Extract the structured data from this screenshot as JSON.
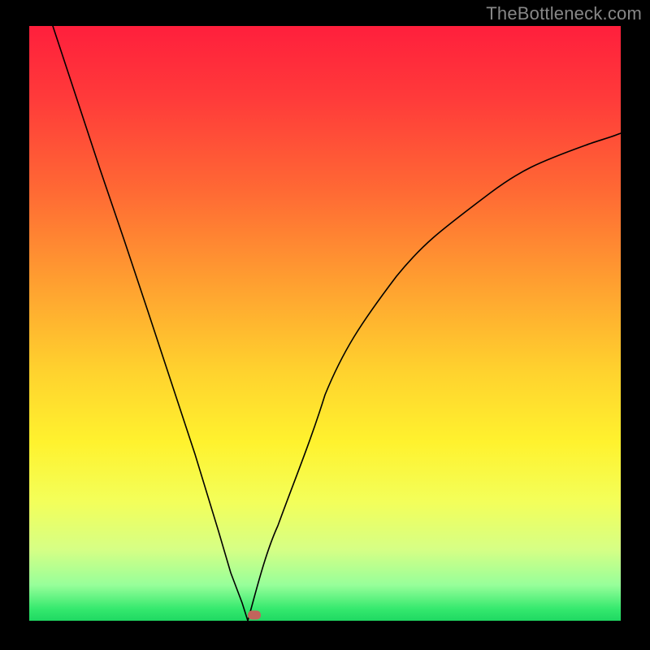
{
  "watermark": "TheBottleneck.com",
  "chart_data": {
    "type": "line",
    "title": "",
    "xlabel": "",
    "ylabel": "",
    "xlim": [
      0,
      100
    ],
    "ylim": [
      0,
      100
    ],
    "grid": false,
    "trough_x": 37,
    "marker": {
      "x": 38,
      "y": 1
    },
    "series": [
      {
        "name": "left-branch",
        "x": [
          4,
          8,
          12,
          16,
          20,
          24,
          28,
          32,
          34,
          36,
          37
        ],
        "y": [
          100,
          88,
          76,
          64,
          52,
          40,
          28,
          15,
          8,
          3,
          0
        ]
      },
      {
        "name": "right-branch",
        "x": [
          37,
          39,
          42,
          46,
          50,
          56,
          62,
          70,
          78,
          86,
          94,
          100
        ],
        "y": [
          0,
          6,
          16,
          28,
          38,
          50,
          58,
          66,
          72,
          77,
          80,
          82
        ]
      }
    ],
    "background_gradient": {
      "stops": [
        {
          "pos": 0,
          "color": "#ff1f3c"
        },
        {
          "pos": 12,
          "color": "#ff3a3a"
        },
        {
          "pos": 28,
          "color": "#ff6a34"
        },
        {
          "pos": 44,
          "color": "#ffa230"
        },
        {
          "pos": 58,
          "color": "#ffd22e"
        },
        {
          "pos": 70,
          "color": "#fff22e"
        },
        {
          "pos": 80,
          "color": "#f3ff5a"
        },
        {
          "pos": 88,
          "color": "#d6ff85"
        },
        {
          "pos": 94,
          "color": "#97ff9a"
        },
        {
          "pos": 98,
          "color": "#35e96e"
        },
        {
          "pos": 100,
          "color": "#1fd862"
        }
      ]
    }
  }
}
